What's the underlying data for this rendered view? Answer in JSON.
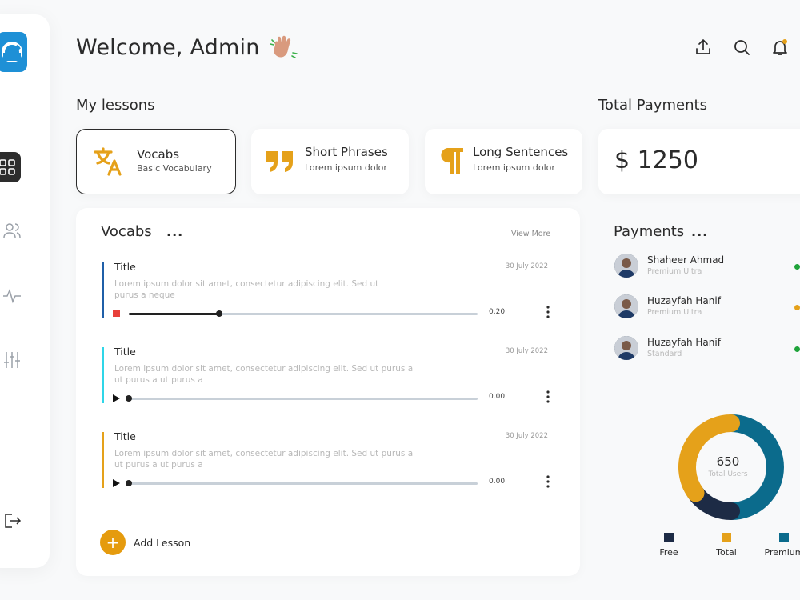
{
  "header": {
    "title": "Welcome, Admin"
  },
  "lessons": {
    "heading": "My lessons",
    "cards": [
      {
        "title": "Vocabs",
        "subtitle": "Basic Vocabulary",
        "icon": "translate-icon",
        "active": true
      },
      {
        "title": "Short Phrases",
        "subtitle": "Lorem ipsum dolor",
        "icon": "quote-icon",
        "active": false
      },
      {
        "title": "Long Sentences",
        "subtitle": "Lorem ipsum dolor",
        "icon": "pilcrow-icon",
        "active": false
      }
    ]
  },
  "total_payments": {
    "heading": "Total Payments",
    "amount": "$ 1250"
  },
  "vocabs_panel": {
    "heading": "Vocabs",
    "more_dots": "...",
    "view_more": "View More",
    "items": [
      {
        "title": "Title",
        "date": "30 July 2022",
        "text": "Lorem ipsum dolor sit amet, consectetur adipiscing elit. Sed ut purus a neque",
        "time": "0.20",
        "color": "#1f5fa8",
        "state": "playing",
        "progress": 0.26
      },
      {
        "title": "Title",
        "date": "30 July 2022",
        "text": "Lorem ipsum dolor sit amet, consectetur adipiscing elit. Sed ut purus a ut purus a ut purus a",
        "time": "0.00",
        "color": "#2fd6e8",
        "state": "paused",
        "progress": 0
      },
      {
        "title": "Title",
        "date": "30 July 2022",
        "text": "Lorem ipsum dolor sit amet, consectetur adipiscing elit. Sed ut purus a ut purus a ut purus a",
        "time": "0.00",
        "color": "#e5a11a",
        "state": "paused",
        "progress": 0
      }
    ],
    "add_label": "Add Lesson"
  },
  "payments": {
    "heading": "Payments",
    "more_dots": "...",
    "rows": [
      {
        "name": "Shaheer Ahmad",
        "tier": "Premium Ultra",
        "status_color": "#1fa33a"
      },
      {
        "name": "Huzayfah Hanif",
        "tier": "Premium Ultra",
        "status_color": "#e5a11a"
      },
      {
        "name": "Huzayfah Hanif",
        "tier": "Standard",
        "status_color": "#1fa33a"
      }
    ]
  },
  "users_chart": {
    "total": "650",
    "total_label": "Total Users"
  },
  "chart_data": {
    "type": "pie",
    "categories": [
      "Free",
      "Total",
      "Premium"
    ],
    "values": [
      15,
      35,
      50
    ],
    "colors": [
      "#1d2b45",
      "#e5a11a",
      "#0b6b8c"
    ],
    "legend": "bottom"
  },
  "colors": {
    "accent": "#e5a11a",
    "logo": "#1e90d6"
  }
}
